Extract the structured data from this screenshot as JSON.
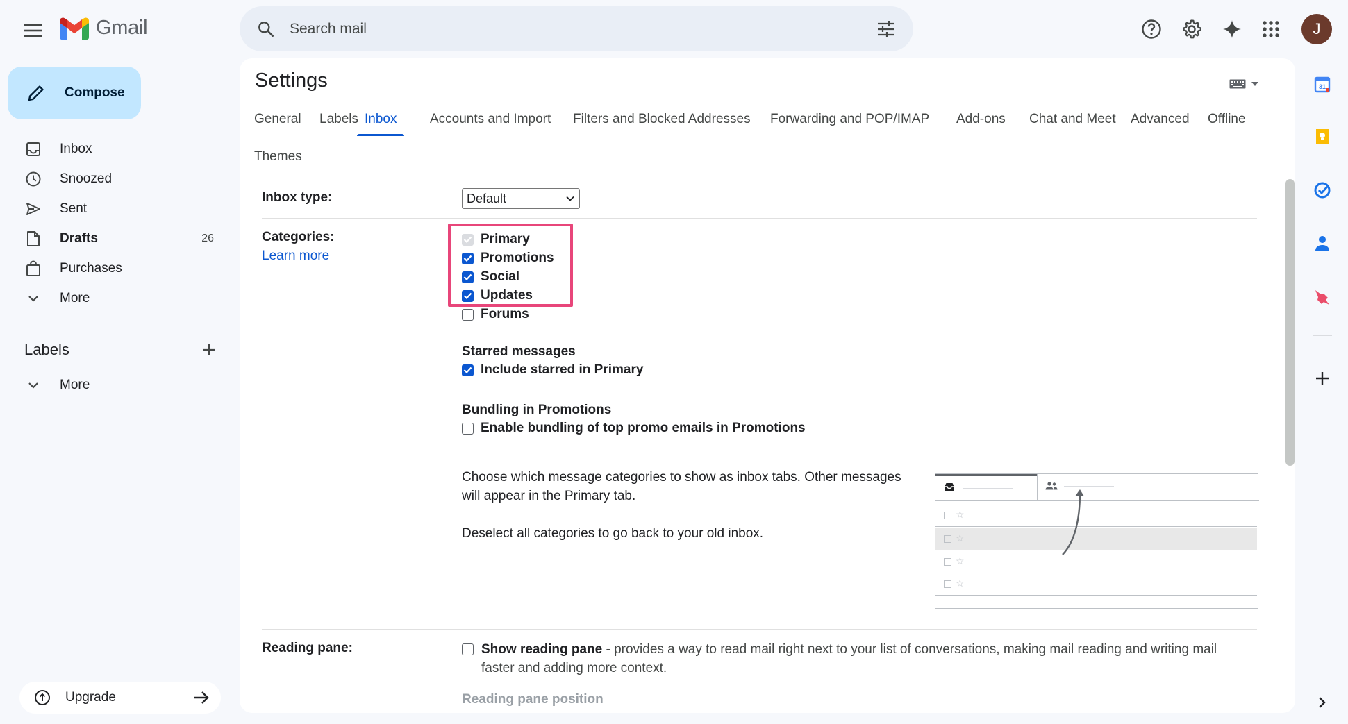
{
  "app": {
    "name": "Gmail"
  },
  "search": {
    "placeholder": "Search mail"
  },
  "nav": {
    "compose_label": "Compose",
    "items": [
      {
        "label": "Inbox",
        "count": ""
      },
      {
        "label": "Snoozed",
        "count": ""
      },
      {
        "label": "Sent",
        "count": ""
      },
      {
        "label": "Drafts",
        "count": "26"
      },
      {
        "label": "Purchases",
        "count": ""
      },
      {
        "label": "More",
        "count": ""
      }
    ],
    "labels_title": "Labels",
    "labels_more": "More",
    "upgrade_label": "Upgrade"
  },
  "user": {
    "avatar_letter": "J"
  },
  "settings": {
    "title": "Settings",
    "tabs": [
      "General",
      "Labels",
      "Inbox",
      "Accounts and Import",
      "Filters and Blocked Addresses",
      "Forwarding and POP/IMAP",
      "Add-ons",
      "Chat and Meet",
      "Advanced",
      "Offline",
      "Themes"
    ],
    "active_tab": "Inbox",
    "inbox_type": {
      "label": "Inbox type:",
      "value": "Default"
    },
    "categories": {
      "label": "Categories:",
      "learn_more": "Learn more",
      "items": [
        {
          "label": "Primary",
          "checked": true,
          "disabled": true
        },
        {
          "label": "Promotions",
          "checked": true
        },
        {
          "label": "Social",
          "checked": true
        },
        {
          "label": "Updates",
          "checked": true
        },
        {
          "label": "Forums",
          "checked": false
        }
      ]
    },
    "starred": {
      "heading": "Starred messages",
      "option": "Include starred in Primary",
      "checked": true
    },
    "bundling": {
      "heading": "Bundling in Promotions",
      "option": "Enable bundling of top promo emails in Promotions",
      "checked": false
    },
    "help_text_1": "Choose which message categories to show as inbox tabs. Other messages will appear in the Primary tab.",
    "help_text_2": "Deselect all categories to go back to your old inbox.",
    "reading_pane": {
      "label": "Reading pane:",
      "option_bold": "Show reading pane",
      "option_rest": " - provides a way to read mail right next to your list of conversations, making mail reading and writing mail faster and adding more context.",
      "checked": false,
      "position_label": "Reading pane position"
    }
  },
  "colors": {
    "accent": "#0b57d0",
    "compose_bg": "#c2e7ff",
    "highlight_border": "#e8467a",
    "app_bg": "#f6f8fc"
  }
}
